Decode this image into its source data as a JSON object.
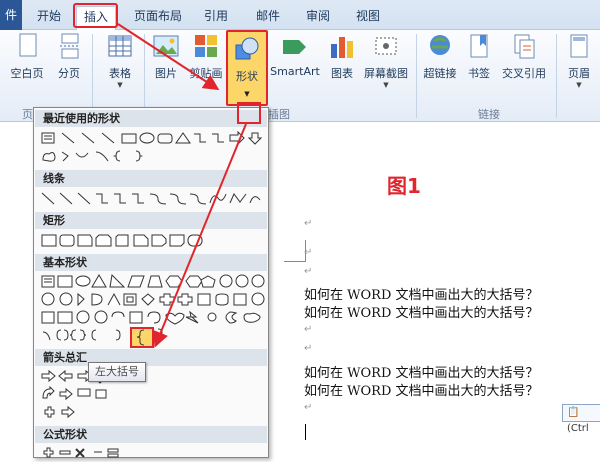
{
  "tabs": {
    "file": "件",
    "home": "开始",
    "insert": "插入",
    "layout": "页面布局",
    "references": "引用",
    "mailings": "邮件",
    "review": "审阅",
    "view": "视图"
  },
  "ribbon": {
    "blank_page": "空白页",
    "page_break": "分页",
    "table": "表格",
    "picture": "图片",
    "clip_art": "剪贴画",
    "shapes": "形状",
    "smartart": "SmartArt",
    "chart": "图表",
    "screenshot": "屏幕截图",
    "hyperlink": "超链接",
    "bookmark": "书签",
    "cross_ref": "交叉引用",
    "header": "页眉",
    "group_pages": "页",
    "group_illustrations": "插图",
    "group_links": "链接"
  },
  "shapes_menu": {
    "recent": "最近使用的形状",
    "lines": "线条",
    "rectangles": "矩形",
    "basic": "基本形状",
    "arrows": "箭头总汇",
    "equation": "公式形状",
    "tooltip": "左大括号"
  },
  "document": {
    "figure_label": "图1",
    "paragraph_mark": "↵",
    "lines": [
      "如何在 WORD 文档中画出大的大括号？",
      "如何在 WORD 文档中画出大的大括号？",
      "如何在 WORD 文档中画出大的大括号？",
      "如何在 WORD 文档中画出大的大括号？"
    ],
    "paste_options": "(Ctrl"
  },
  "colors": {
    "accent_red": "#e0262c",
    "highlight": "#fdd66a"
  }
}
